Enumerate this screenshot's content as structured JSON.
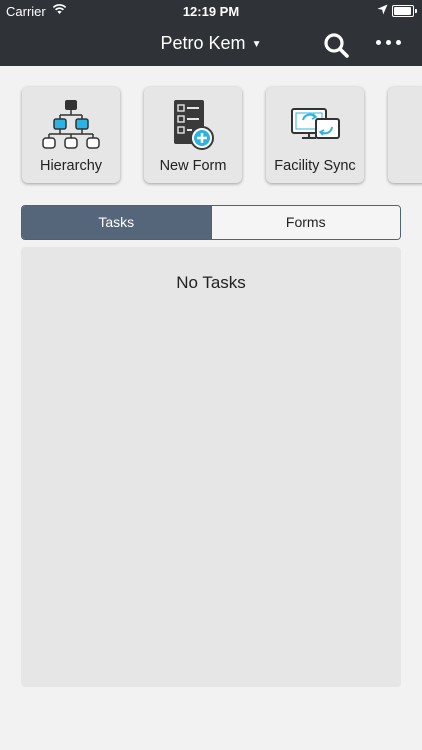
{
  "status_bar": {
    "carrier": "Carrier",
    "time": "12:19 PM",
    "battery_level": 0.95
  },
  "nav": {
    "title": "Petro Kem",
    "search_icon": "search-icon",
    "more_icon": "more-horizontal-icon"
  },
  "tiles": [
    {
      "label": "Hierarchy",
      "icon": "hierarchy-icon"
    },
    {
      "label": "New Form",
      "icon": "new-form-icon"
    },
    {
      "label": "Facility Sync",
      "icon": "facility-sync-icon"
    }
  ],
  "segments": {
    "tasks": "Tasks",
    "forms": "Forms",
    "selected": "Tasks"
  },
  "panel": {
    "empty_message": "No Tasks"
  },
  "colors": {
    "bar": "#2f3337",
    "segment_active": "#55667a",
    "accent_blue": "#2bb3e5"
  }
}
